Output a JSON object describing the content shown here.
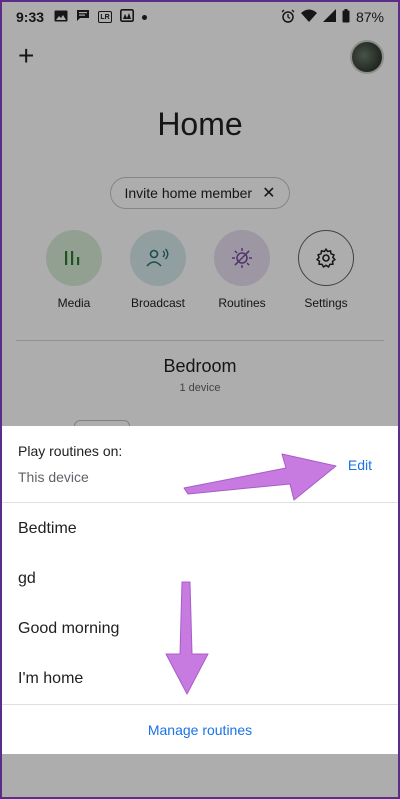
{
  "status_bar": {
    "time": "9:33",
    "battery": "87%",
    "icons": [
      "image-icon",
      "message-icon",
      "lr-icon",
      "photos-icon",
      "dot-icon",
      "alarm-icon",
      "wifi-icon",
      "signal-icon",
      "battery-icon"
    ],
    "lr_text": "LR"
  },
  "header": {
    "add_symbol": "+",
    "title": "Home"
  },
  "invite_chip": {
    "label": "Invite home member",
    "close_symbol": "✕"
  },
  "actions": [
    {
      "label": "Media",
      "icon": "media-icon",
      "color": "#d7ecd8"
    },
    {
      "label": "Broadcast",
      "icon": "broadcast-icon",
      "color": "#d8ebee"
    },
    {
      "label": "Routines",
      "icon": "routines-icon",
      "color": "#e7dff1"
    },
    {
      "label": "Settings",
      "icon": "gear-icon",
      "color": "#ffffff"
    }
  ],
  "room": {
    "name": "Bedroom",
    "device_count": "1 device"
  },
  "sheet": {
    "heading": "Play routines on:",
    "device": "This device",
    "edit_label": "Edit",
    "routines": [
      "Bedtime",
      "gd",
      "Good morning",
      "I'm home"
    ],
    "manage_label": "Manage routines"
  },
  "colors": {
    "accent": "#1a73e8",
    "arrow": "#c77be0",
    "frame": "#5b2d8a"
  }
}
